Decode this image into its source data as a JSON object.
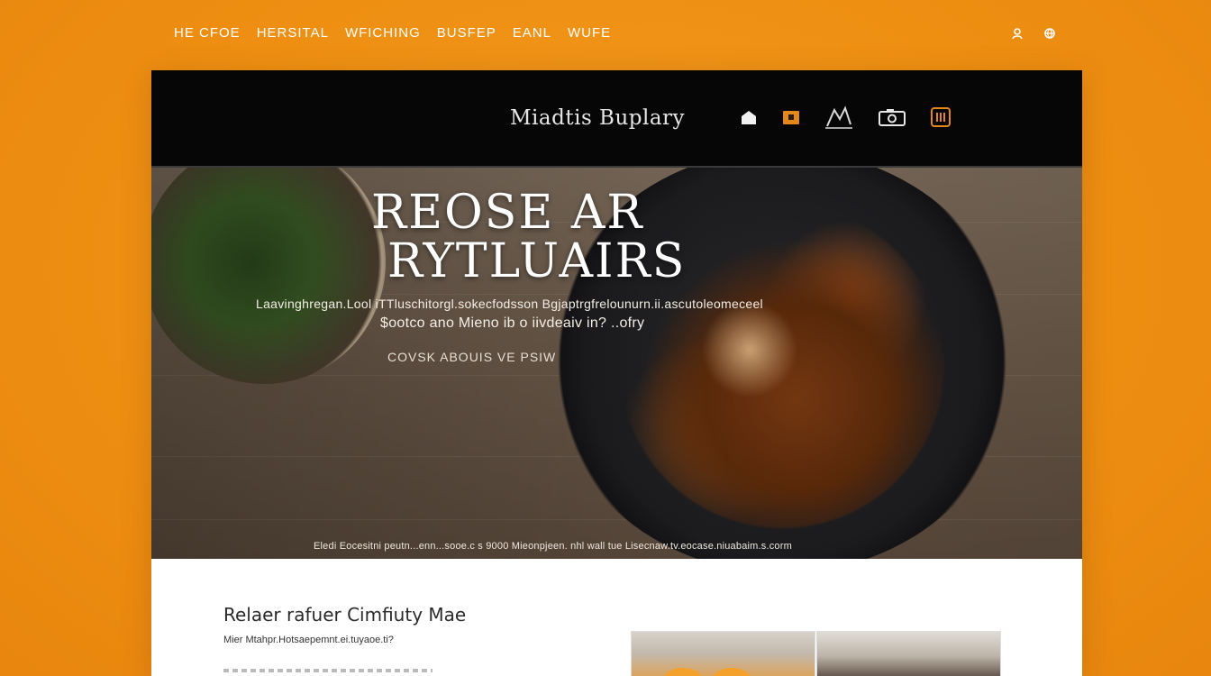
{
  "topnav": {
    "items": [
      "HE CFOE",
      "HERSITAL",
      "WFICHING",
      "BUSFEP",
      "EANL",
      "WUFE"
    ],
    "icons": [
      "user-icon",
      "globe-icon"
    ]
  },
  "header": {
    "site_title": "Miadtis Buplary",
    "icons": [
      "home-icon",
      "calendar-icon",
      "chart-icon",
      "camera-icon",
      "menu-icon"
    ],
    "accent_color": "#e3861b"
  },
  "hero": {
    "title_line_1": "REOSE AR",
    "title_line_2": "RYTLUAIRS",
    "line_1": "Laavinghregan.Lool  iTTluschitorgl.sokecfodsson  Bgjaptrgfrelounurn.ii.ascutoleomeceel",
    "line_2": "$ootco ano Mieno ib o iivdeaiv in?  ..ofry",
    "cta": "COVSK ABOUIS VE PSIW",
    "caption": "Eledi Eocesitni  peutn...enn...sooe.c s 9000 Mieonpjeen. nhl wall tue Lisecnaw.tv.eocase.niuabaim.s.corm"
  },
  "section": {
    "title": "Relaer rafuer Cimfiuty Mae",
    "subtitle": "Mier Mtahpr.Hotsaepemnt.ei.tuyaoe.ti?"
  },
  "colors": {
    "background": "#ee8f12",
    "header_bg": "#060606",
    "hero_text": "#ffffff"
  }
}
